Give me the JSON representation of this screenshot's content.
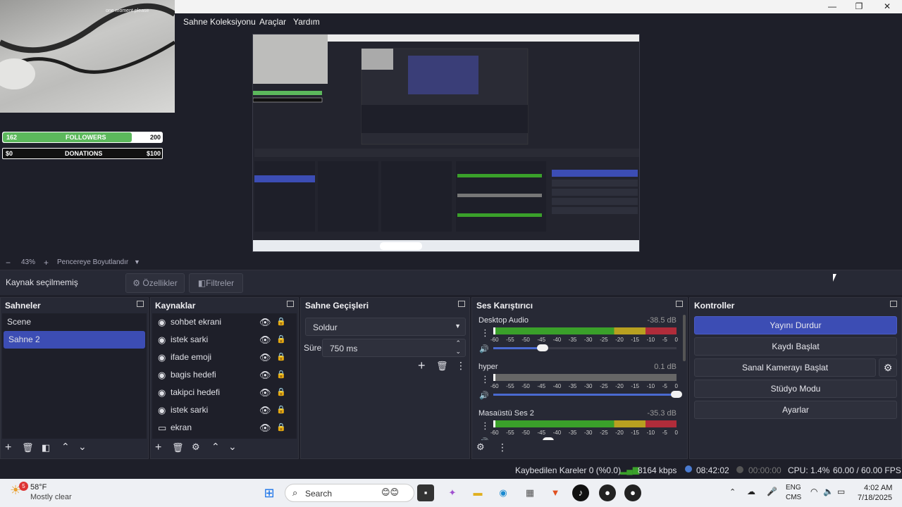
{
  "window": {
    "minimize": "—",
    "maximize": "❐",
    "close": "✕"
  },
  "menu": {
    "items": [
      "Sahne Koleksiyonu",
      "Araçlar",
      "Yardım"
    ]
  },
  "overlay": {
    "followers": {
      "current": "162",
      "label": "FOLLOWERS",
      "goal": "200",
      "progress": 0.81
    },
    "donations": {
      "current": "$0",
      "label": "DONATIONS",
      "goal": "$100",
      "progress": 0.0
    },
    "cam_caption": "one moment please"
  },
  "zoom": {
    "minus": "−",
    "value": "43%",
    "plus": "+",
    "fit_label": "Pencereye Boyutlandır",
    "arrow": "▼"
  },
  "source_bar": {
    "status": "Kaynak seçilmemiş",
    "properties": "Özellikler",
    "filters": "Filtreler"
  },
  "scenes": {
    "title": "Sahneler",
    "items": [
      "Scene",
      "Sahne 2"
    ],
    "selected_index": 1
  },
  "sources": {
    "title": "Kaynaklar",
    "items": [
      {
        "name": "sohbet ekrani",
        "icon": "globe-icon"
      },
      {
        "name": "istek sarki",
        "icon": "globe-icon"
      },
      {
        "name": "ifade emoji",
        "icon": "globe-icon"
      },
      {
        "name": "bagis hedefi",
        "icon": "globe-icon"
      },
      {
        "name": "takipci hedefi",
        "icon": "globe-icon"
      },
      {
        "name": "istek sarki",
        "icon": "globe-icon"
      },
      {
        "name": "ekran",
        "icon": "monitor-icon"
      }
    ]
  },
  "transitions": {
    "title": "Sahne Geçişleri",
    "selected": "Soldur",
    "duration_label": "Süre",
    "duration_value": "750 ms"
  },
  "mixer": {
    "title": "Ses Karıştırıcı",
    "channels": [
      {
        "name": "Desktop Audio",
        "db": "-38.5 dB",
        "volume": 0.27,
        "muted": false
      },
      {
        "name": "hyper",
        "db": "0.1 dB",
        "volume": 1.0,
        "muted": true
      },
      {
        "name": "Masaüstü Ses 2",
        "db": "-35.3 dB",
        "volume": 0.3,
        "muted": false
      }
    ],
    "ticks": [
      "-60",
      "-55",
      "-50",
      "-45",
      "-40",
      "-35",
      "-30",
      "-25",
      "-20",
      "-15",
      "-10",
      "-5",
      "0"
    ]
  },
  "controls": {
    "title": "Kontroller",
    "stop_stream": "Yayını Durdur",
    "start_recording": "Kaydı Başlat",
    "start_virtual_cam": "Sanal Kamerayı Başlat",
    "studio_mode": "Stüdyo Modu",
    "settings": "Ayarlar"
  },
  "status": {
    "dropped_frames": "Kaybedilen Kareler 0 (%0.0)",
    "bitrate": "8164 kbps",
    "stream_time": "08:42:02",
    "record_time": "00:00:00",
    "cpu": "CPU: 1.4%",
    "fps": "60.00 / 60.00 FPS"
  },
  "taskbar": {
    "weather_temp": "58°F",
    "weather_desc": "Mostly clear",
    "weather_badge": "5",
    "search_placeholder": "Search",
    "lang_top": "ENG",
    "lang_bottom": "CMS",
    "time": "4:02 AM",
    "date": "7/18/2025"
  },
  "colors": {
    "accent": "#3c4db4",
    "followers_bar": "#5cb85c",
    "meter_green": "#3aa02a",
    "meter_yellow": "#b8a020",
    "meter_red": "#b02c3a"
  }
}
